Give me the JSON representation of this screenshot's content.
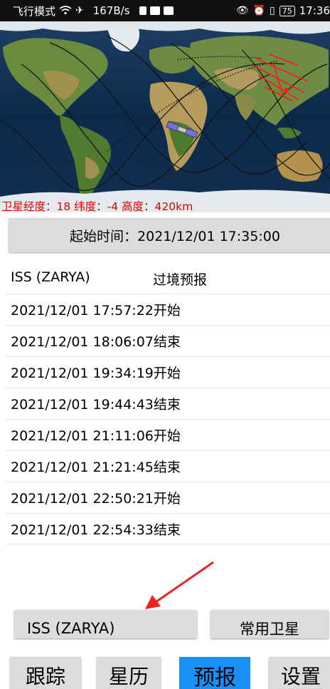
{
  "status_bar": {
    "airplane_mode": "飞行模式",
    "net_speed": "167B/s",
    "battery": "75",
    "time": "17:36",
    "icons": [
      "wifi-icon",
      "airplane-icon",
      "alert-icon",
      "mail-icon",
      "message-icon",
      "eye-icon",
      "alarm-icon",
      "vibrate-icon",
      "battery-icon"
    ]
  },
  "map": {
    "satellite_info": "卫星经度：18 纬度：-4 高度：420km",
    "colors": {
      "track": "#000000",
      "visibility": "#ff0000",
      "ocean": "#0b2a4a",
      "land": "#5c7a3a",
      "info_text": "#e00000"
    }
  },
  "start_time": {
    "label": "起始时间：2021/12/01 17:35:00"
  },
  "forecast": {
    "satellite_name": "ISS (ZARYA)",
    "title": "过境预报",
    "passes": [
      "2021/12/01 17:57:22开始",
      "2021/12/01 18:06:07结束",
      "2021/12/01 19:34:19开始",
      "2021/12/01 19:44:43结束",
      "2021/12/01 21:11:06开始",
      "2021/12/01 21:21:45结束",
      "2021/12/01 22:50:21开始",
      "2021/12/01 22:54:33结束"
    ]
  },
  "controls": {
    "satellite_select": "ISS (ZARYA)",
    "common_satellites": "常用卫星"
  },
  "nav": {
    "track": "跟踪",
    "ephemeris": "星历",
    "forecast": "预报",
    "settings": "设置",
    "active_color": "#1a8ff5"
  }
}
